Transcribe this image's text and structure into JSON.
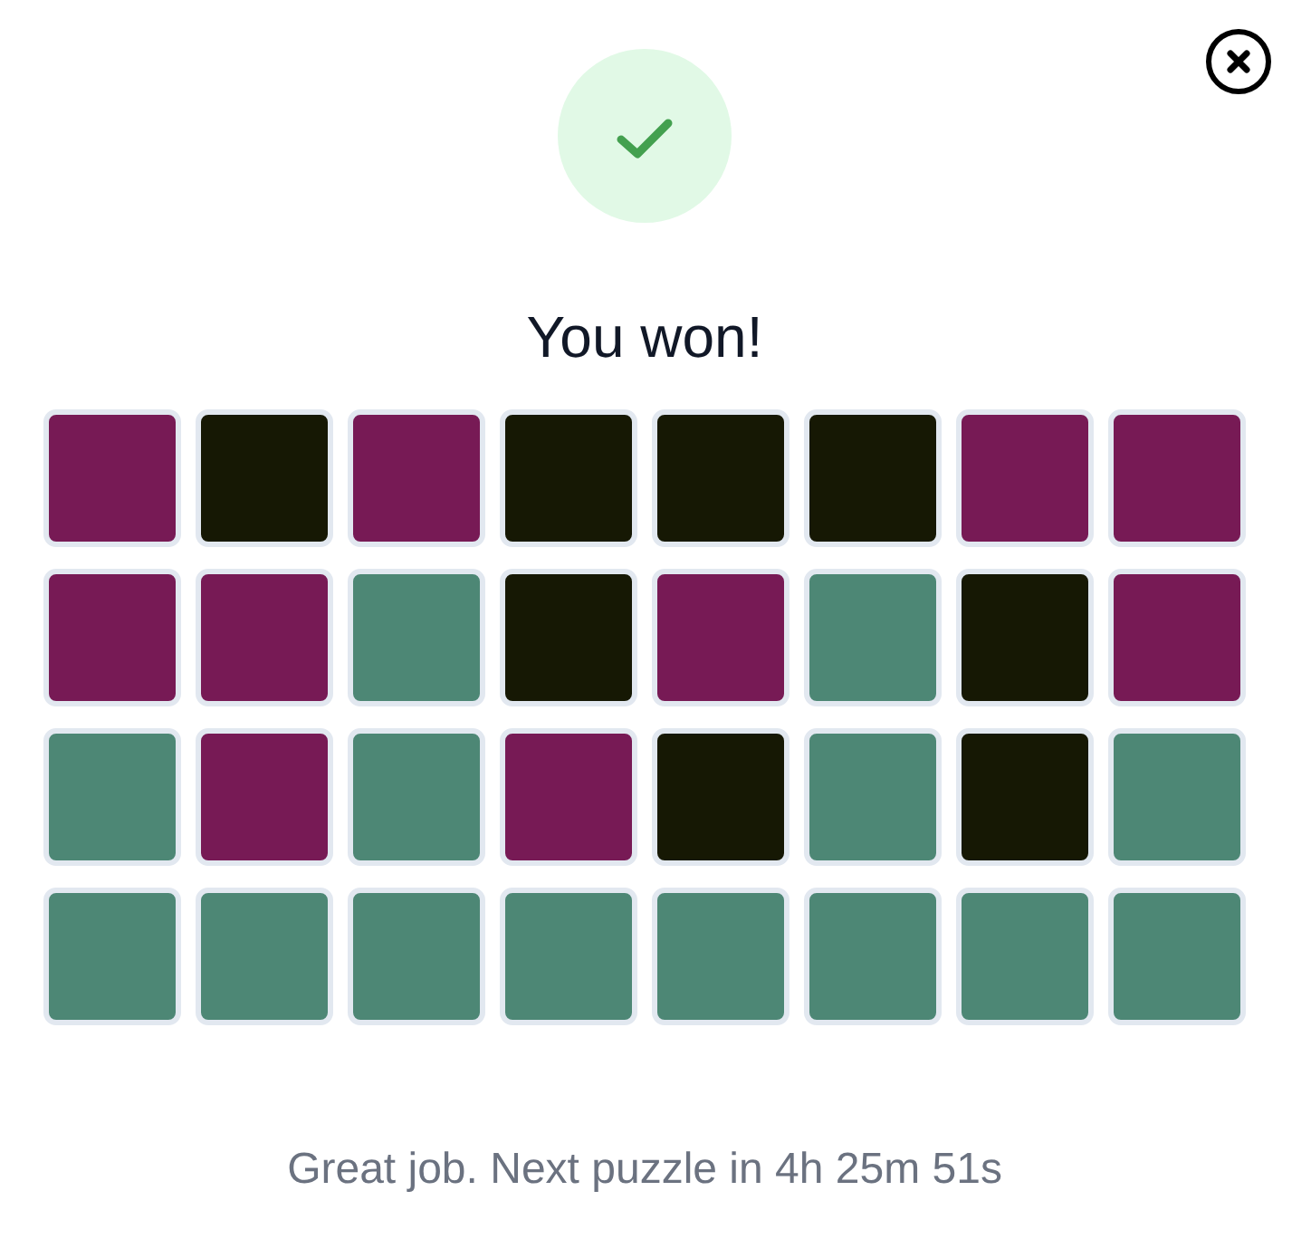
{
  "title": "You won!",
  "grid": {
    "rows": [
      {
        "tiles": [
          {
            "color": "#771a55"
          },
          {
            "color": "#161804"
          },
          {
            "color": "#771a55"
          },
          {
            "color": "#161804"
          },
          {
            "color": "#161804"
          },
          {
            "color": "#161804"
          },
          {
            "color": "#771a55"
          },
          {
            "color": "#771a55"
          }
        ]
      },
      {
        "tiles": [
          {
            "color": "#771a55"
          },
          {
            "color": "#771a55"
          },
          {
            "color": "#4d8775"
          },
          {
            "color": "#161804"
          },
          {
            "color": "#771a55"
          },
          {
            "color": "#4d8775"
          },
          {
            "color": "#161804"
          },
          {
            "color": "#771a55"
          }
        ]
      },
      {
        "tiles": [
          {
            "color": "#4d8775"
          },
          {
            "color": "#771a55"
          },
          {
            "color": "#4d8775"
          },
          {
            "color": "#771a55"
          },
          {
            "color": "#161804"
          },
          {
            "color": "#4d8775"
          },
          {
            "color": "#161804"
          },
          {
            "color": "#4d8775"
          }
        ]
      },
      {
        "tiles": [
          {
            "color": "#4d8775"
          },
          {
            "color": "#4d8775"
          },
          {
            "color": "#4d8775"
          },
          {
            "color": "#4d8775"
          },
          {
            "color": "#4d8775"
          },
          {
            "color": "#4d8775"
          },
          {
            "color": "#4d8775"
          },
          {
            "color": "#4d8775"
          }
        ]
      }
    ]
  },
  "message": "Great job. Next puzzle in 4h 25m 51s"
}
